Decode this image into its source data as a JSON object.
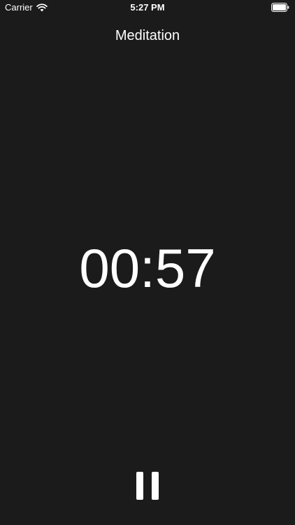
{
  "status_bar": {
    "carrier": "Carrier",
    "time": "5:27 PM",
    "wifi_icon": "wifi-icon",
    "battery_icon": "battery-icon"
  },
  "nav": {
    "title": "Meditation"
  },
  "timer": {
    "display": "00:57"
  },
  "controls": {
    "pause_icon": "pause-icon"
  },
  "colors": {
    "background": "#1b1b1b",
    "foreground": "#ffffff"
  }
}
